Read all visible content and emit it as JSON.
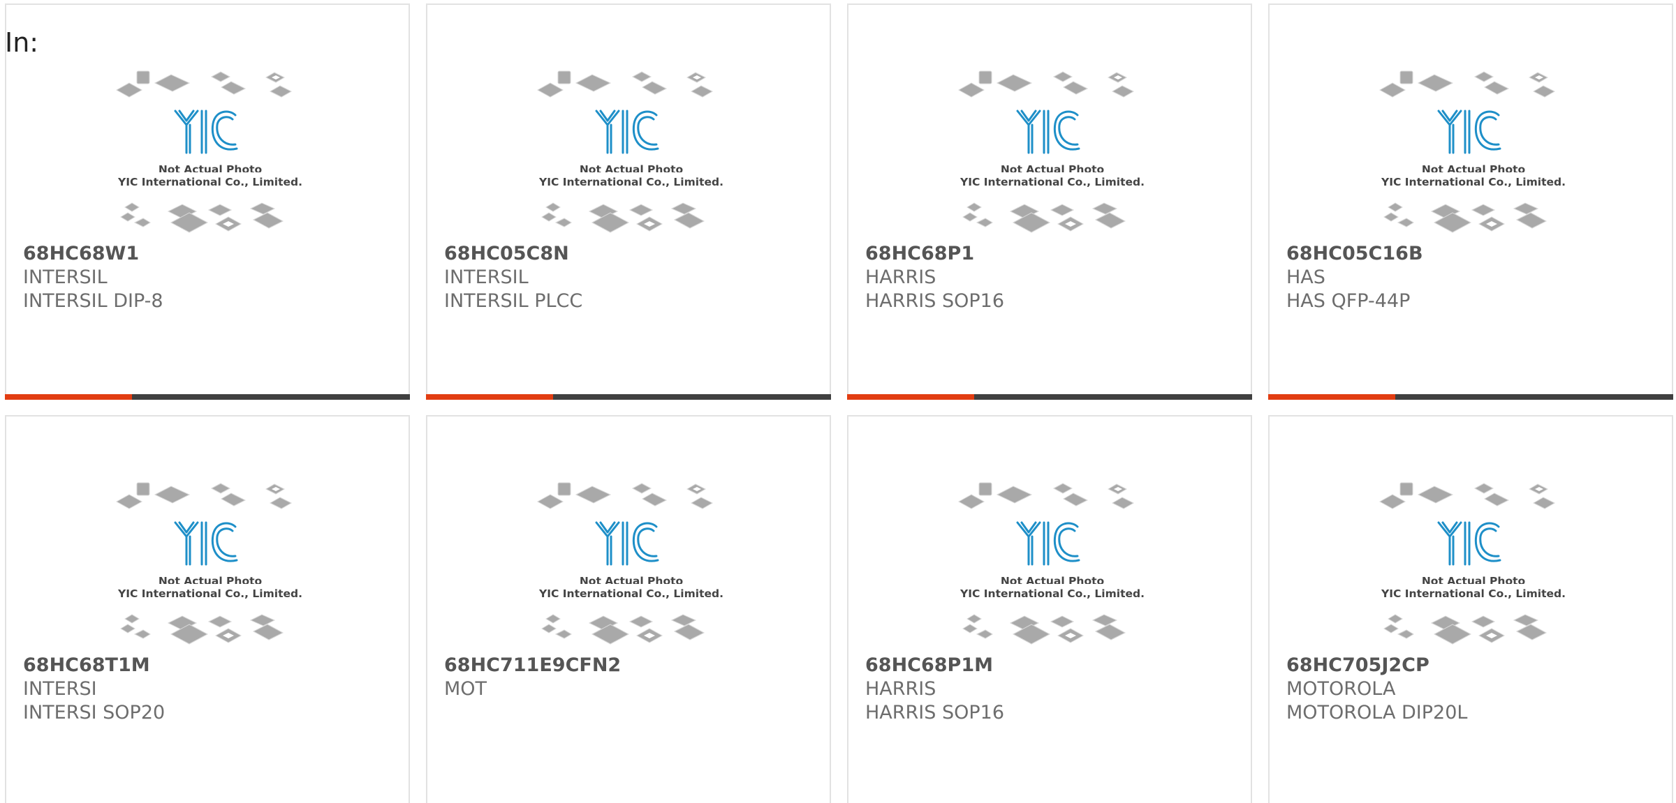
{
  "page": {
    "heading": "In:"
  },
  "theme": {
    "accent_color": "#e23d12",
    "bar_color": "#404040",
    "logo_color": "#1e8fc8",
    "chip_color": "#9e9e9e"
  },
  "watermark": {
    "logo_text": "YIC",
    "line1": "Not Actual Photo",
    "line2": "YIC International Co., Limited."
  },
  "products": [
    {
      "part": "68HC68W1",
      "brand": "INTERSIL",
      "package": "INTERSIL DIP-8",
      "bar": true
    },
    {
      "part": "68HC05C8N",
      "brand": "INTERSIL",
      "package": "INTERSIL PLCC",
      "bar": true
    },
    {
      "part": "68HC68P1",
      "brand": "HARRIS",
      "package": "HARRIS SOP16",
      "bar": true
    },
    {
      "part": "68HC05C16B",
      "brand": "HAS",
      "package": "HAS QFP-44P",
      "bar": true
    },
    {
      "part": "68HC68T1M",
      "brand": "INTERSI",
      "package": "INTERSI SOP20",
      "bar": false
    },
    {
      "part": "68HC711E9CFN2",
      "brand": "MOT",
      "package": "",
      "bar": false
    },
    {
      "part": "68HC68P1M",
      "brand": "HARRIS",
      "package": "HARRIS SOP16",
      "bar": false
    },
    {
      "part": "68HC705J2CP",
      "brand": "MOTOROLA",
      "package": "MOTOROLA DIP20L",
      "bar": false
    }
  ]
}
